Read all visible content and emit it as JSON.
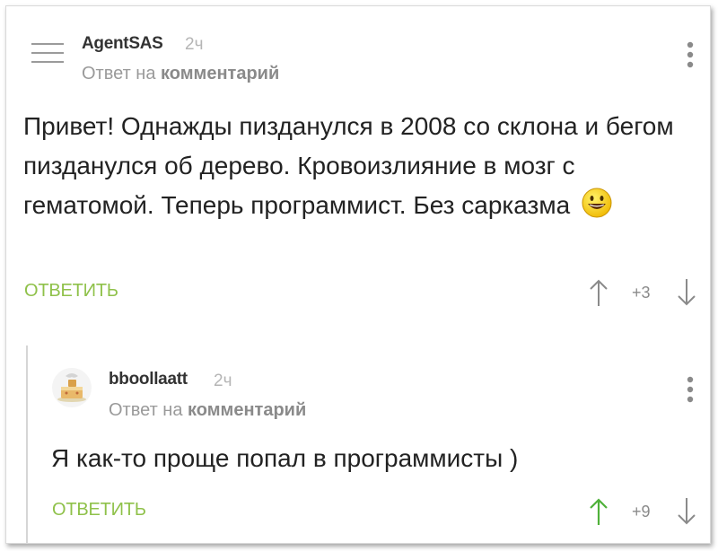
{
  "colors": {
    "accent": "#8fc14a",
    "text": "#222222",
    "muted": "#9a9a9a"
  },
  "comments": [
    {
      "author": "AgentSAS",
      "time": "2ч",
      "reply_prefix": "Ответ на",
      "reply_target": "комментарий",
      "text": "Привет! Однажды пизданулся в 2008 со склона и бегом пизданулся об дерево. Кровоизлияние в мозг с гематомой. Теперь программист. Без сарказма",
      "answer_label": "ОТВЕТИТЬ",
      "rating": "+3",
      "icons": [
        "menu-lines-icon",
        "kebab-menu-icon",
        "arrow-up-icon",
        "arrow-down-icon",
        "smiley-emoji-icon"
      ]
    },
    {
      "author": "bboollaatt",
      "time": "2ч",
      "reply_prefix": "Ответ на",
      "reply_target": "комментарий",
      "text": "Я как-то проще попал в программисты )",
      "answer_label": "ОТВЕТИТЬ",
      "rating": "+9",
      "icons": [
        "avatar-cake-icon",
        "kebab-menu-icon",
        "arrow-up-icon",
        "arrow-down-icon"
      ]
    }
  ]
}
